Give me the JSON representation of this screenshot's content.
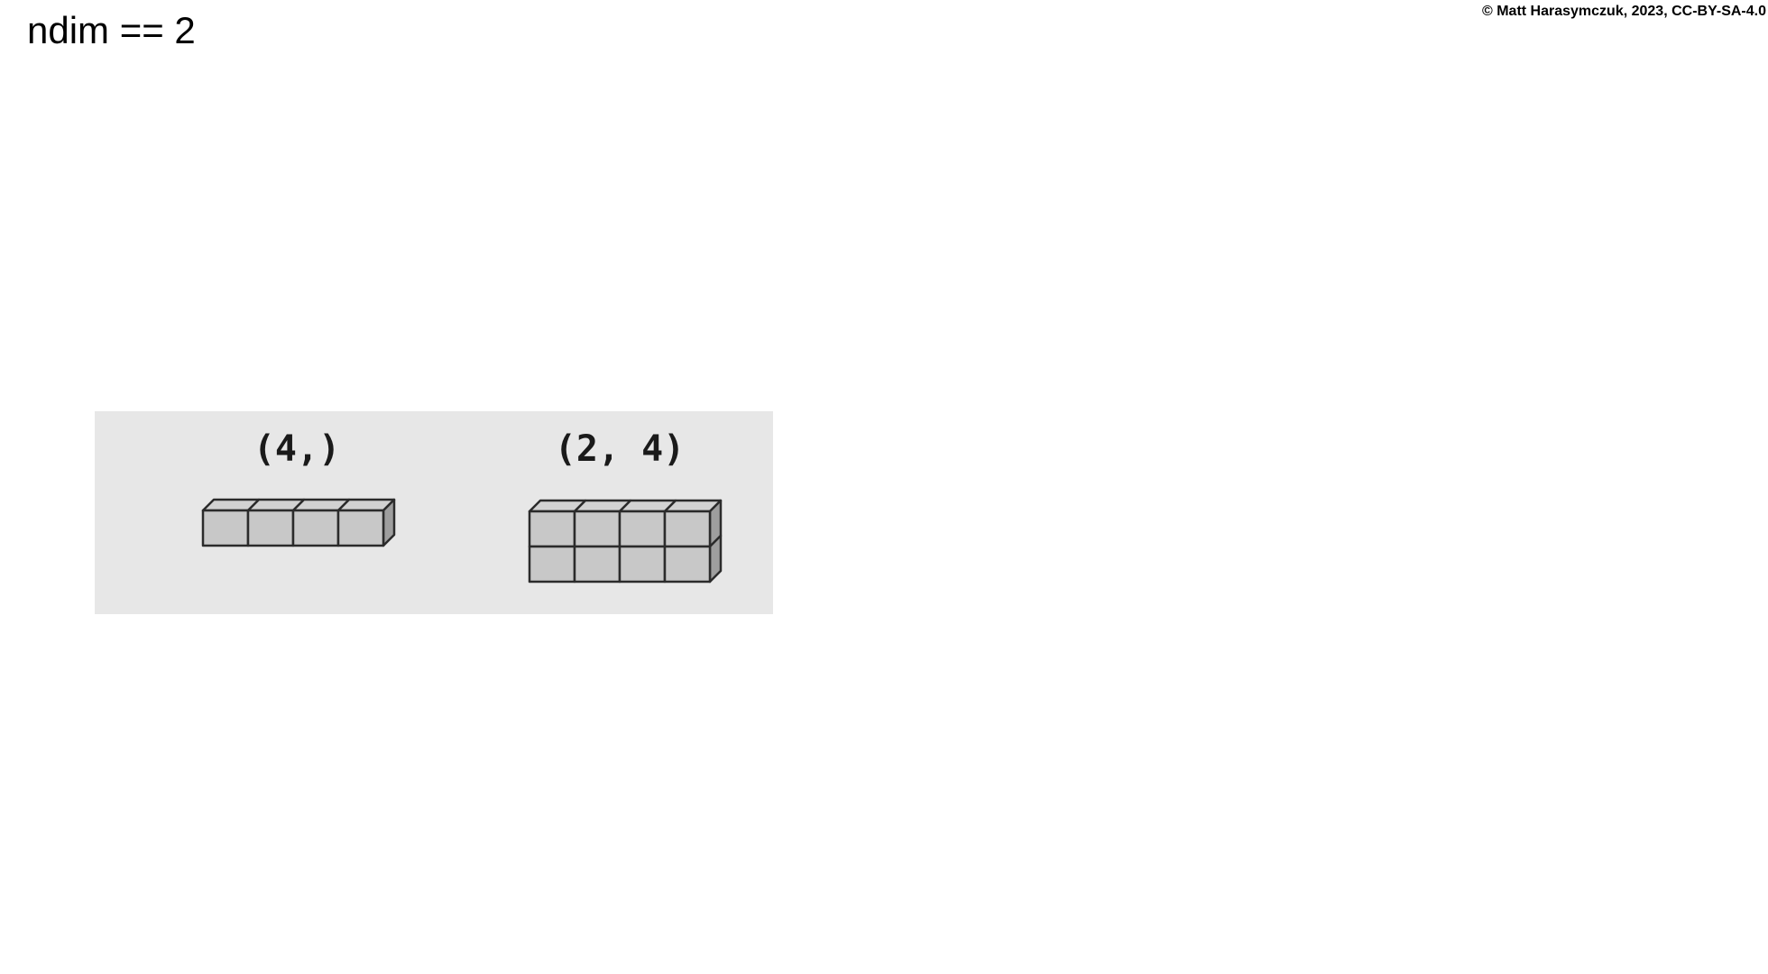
{
  "slide": {
    "title": "ndim == 2",
    "copyright": "© Matt Harasymczuk, 2023, CC-BY-SA-4.0"
  },
  "figure": {
    "arrays": [
      {
        "shape_label": "(4,)",
        "rows": 1,
        "cols": 4
      },
      {
        "shape_label": "(2, 4)",
        "rows": 2,
        "cols": 4
      }
    ],
    "colors": {
      "panel_background": "#e7e7e7",
      "cube_face": "#c8c8c8",
      "cube_top": "#d2d2d2",
      "cube_side": "#9e9e9e",
      "cube_edge": "#2b2b2b"
    }
  }
}
